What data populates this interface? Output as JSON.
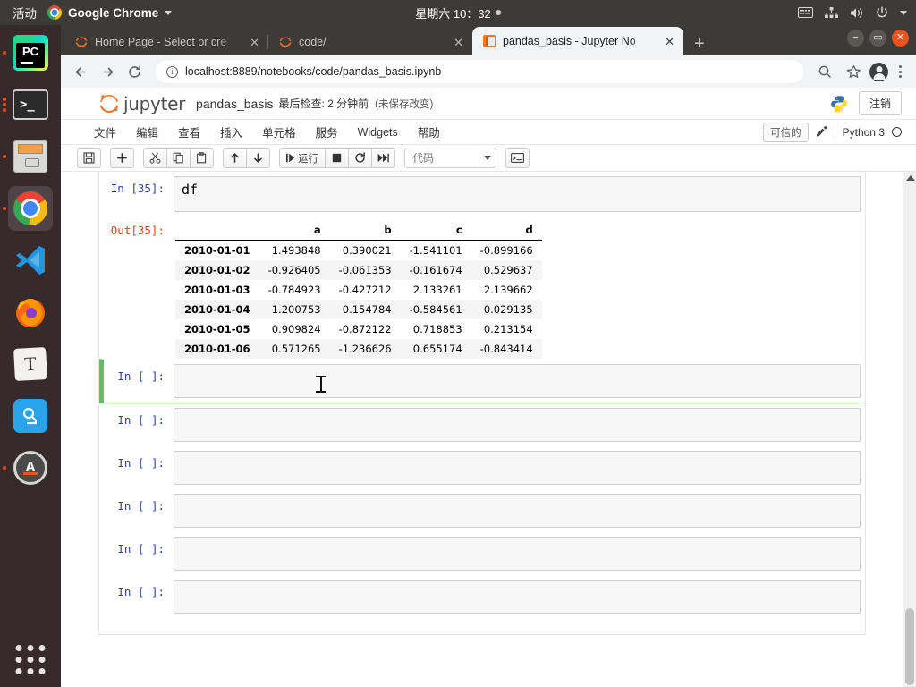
{
  "system_bar": {
    "activities": "活动",
    "app_name": "Google Chrome",
    "app_menu_icon": "chrome-icon",
    "clock": "星期六 10：32",
    "tray": [
      {
        "name": "keyboard-layout-icon"
      },
      {
        "name": "network-icon"
      },
      {
        "name": "volume-icon"
      },
      {
        "name": "power-icon"
      },
      {
        "name": "chevron-down-icon"
      }
    ]
  },
  "dock": {
    "items": [
      {
        "name": "pycharm",
        "label": "PC",
        "running": true,
        "active": false
      },
      {
        "name": "terminal",
        "label": ">_",
        "running": true,
        "active": false
      },
      {
        "name": "files",
        "label": "",
        "running": true,
        "active": false
      },
      {
        "name": "chrome",
        "label": "",
        "running": true,
        "active": true
      },
      {
        "name": "vscode",
        "label": "",
        "running": false,
        "active": false
      },
      {
        "name": "firefox",
        "label": "",
        "running": false,
        "active": false
      },
      {
        "name": "typora",
        "label": "T",
        "running": false,
        "active": false
      },
      {
        "name": "sogou",
        "label": "",
        "running": false,
        "active": false
      },
      {
        "name": "software-updater",
        "label": "A",
        "running": true,
        "active": false
      }
    ],
    "show_applications": "show-applications-grid"
  },
  "browser": {
    "tabs": [
      {
        "title": "Home Page - Select or cre",
        "favicon": "jupyter-icon",
        "active": false
      },
      {
        "title": "code/",
        "favicon": "jupyter-icon",
        "active": false
      },
      {
        "title": "pandas_basis - Jupyter No",
        "favicon": "notebook-icon",
        "active": true
      }
    ],
    "tab_close_label": "✕",
    "new_tab_label": "+",
    "window_controls": {
      "minimize": "−",
      "maximize": "▭",
      "close": "✕"
    },
    "nav": {
      "back": "←",
      "forward": "→",
      "reload": "⟳"
    },
    "address": {
      "site_info_icon": "info-icon",
      "host": "localhost:8889",
      "path": "/notebooks/code/pandas_basis.ipynb",
      "full_url": "localhost:8889/notebooks/code/pandas_basis.ipynb"
    },
    "toolbar_right": [
      {
        "name": "search-icon"
      },
      {
        "name": "bookmark-star-icon"
      },
      {
        "name": "profile-avatar"
      },
      {
        "name": "chrome-menu-icon"
      }
    ]
  },
  "jupyter": {
    "logo_text": "jupyter",
    "notebook_name": "pandas_basis",
    "checkpoint": "最后检查: 2 分钟前",
    "unsaved": "(未保存改变)",
    "logout_label": "注销",
    "python_logo": "python-icon",
    "menus": [
      "文件",
      "编辑",
      "查看",
      "插入",
      "单元格",
      "服务",
      "Widgets",
      "帮助"
    ],
    "trusted_label": "可信的",
    "edit_mode_icon": "pencil-icon",
    "kernel_name": "Python 3",
    "kernel_status": "idle",
    "toolbar": {
      "groups": [
        [
          {
            "name": "save-button",
            "glyph": "💾"
          }
        ],
        [
          {
            "name": "insert-cell-below-button",
            "glyph": "✛"
          }
        ],
        [
          {
            "name": "cut-cell-button",
            "glyph": "✂"
          },
          {
            "name": "copy-cell-button",
            "glyph": "⧉"
          },
          {
            "name": "paste-cell-button",
            "glyph": "📋"
          }
        ],
        [
          {
            "name": "move-cell-up-button",
            "glyph": "↑"
          },
          {
            "name": "move-cell-down-button",
            "glyph": "↓"
          }
        ],
        [
          {
            "name": "run-cell-button",
            "glyph": "▶|",
            "label": "运行"
          },
          {
            "name": "interrupt-kernel-button",
            "glyph": "■"
          },
          {
            "name": "restart-kernel-button",
            "glyph": "⟳"
          },
          {
            "name": "restart-and-run-all-button",
            "glyph": "⏩"
          }
        ]
      ],
      "cell_type": "代码",
      "command_palette": {
        "name": "command-palette-button",
        "glyph": "⌨"
      }
    }
  },
  "notebook": {
    "cells": [
      {
        "prompt": "In [35]:",
        "source": "df",
        "selected": false,
        "output": {
          "prompt": "Out[35]:",
          "type": "dataframe"
        }
      },
      {
        "prompt": "In [ ]:",
        "source": "",
        "selected": true
      },
      {
        "prompt": "In [ ]:",
        "source": "",
        "selected": false
      },
      {
        "prompt": "In [ ]:",
        "source": "",
        "selected": false
      },
      {
        "prompt": "In [ ]:",
        "source": "",
        "selected": false
      },
      {
        "prompt": "In [ ]:",
        "source": "",
        "selected": false
      },
      {
        "prompt": "In [ ]:",
        "source": "",
        "selected": false
      }
    ],
    "dataframe": {
      "index_header": "",
      "columns": [
        "a",
        "b",
        "c",
        "d"
      ],
      "rows": [
        {
          "index": "2010-01-01",
          "values": [
            "1.493848",
            "0.390021",
            "-1.541101",
            "-0.899166"
          ]
        },
        {
          "index": "2010-01-02",
          "values": [
            "-0.926405",
            "-0.061353",
            "-0.161674",
            "0.529637"
          ]
        },
        {
          "index": "2010-01-03",
          "values": [
            "-0.784923",
            "-0.427212",
            "2.133261",
            "2.139662"
          ]
        },
        {
          "index": "2010-01-04",
          "values": [
            "1.200753",
            "0.154784",
            "-0.584561",
            "0.029135"
          ]
        },
        {
          "index": "2010-01-05",
          "values": [
            "0.909824",
            "-0.872122",
            "0.718853",
            "0.213154"
          ]
        },
        {
          "index": "2010-01-06",
          "values": [
            "0.571265",
            "-1.236626",
            "0.655174",
            "-0.843414"
          ]
        }
      ]
    }
  },
  "colors": {
    "jupyter_orange": "#f37726",
    "ubuntu_orange": "#e95420",
    "selected_cell_green": "#66bb6a",
    "prompt_blue": "#303f9f",
    "prompt_red": "#d84315"
  }
}
